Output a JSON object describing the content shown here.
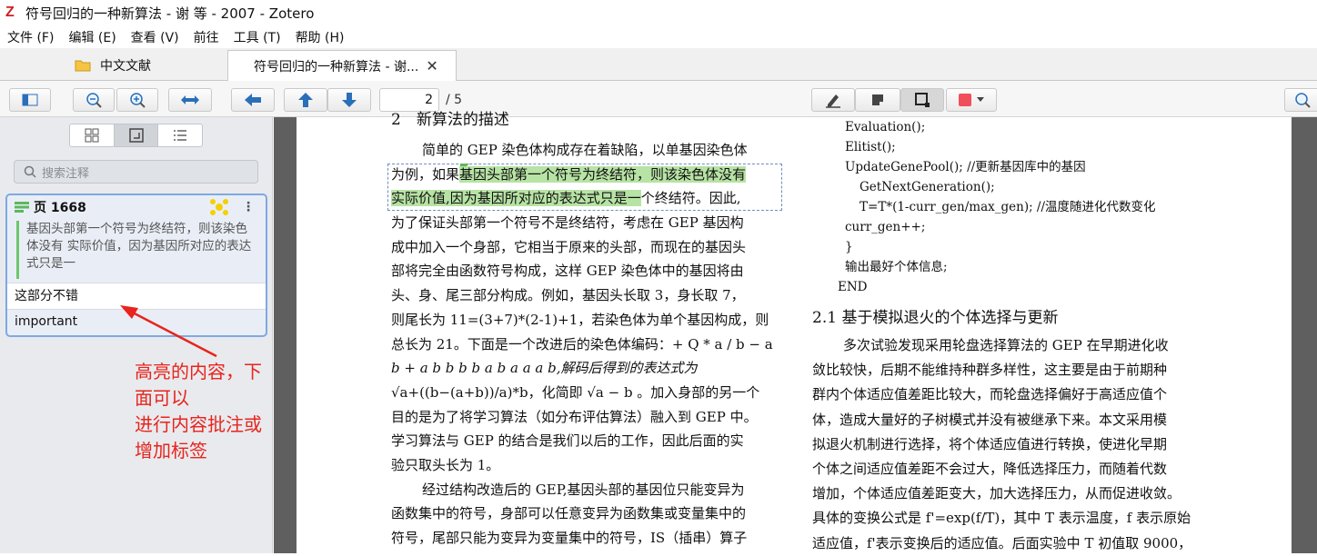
{
  "window": {
    "title": "符号回归的一种新算法 - 谢 等 - 2007 - Zotero"
  },
  "menu": [
    "文件 (F)",
    "编辑 (E)",
    "查看 (V)",
    "前往",
    "工具 (T)",
    "帮助 (H)"
  ],
  "tabs": [
    {
      "label": "中文文献"
    },
    {
      "label": "符号回归的一种新算法 - 谢...",
      "close": "✕"
    }
  ],
  "toolbar": {
    "page_current": "2",
    "page_total": "/ 5"
  },
  "sidebar": {
    "search_placeholder": "搜索注释",
    "annotation": {
      "page_label": "页 1668",
      "quote": "基因头部第一个符号为终结符，则该染色体没有 实际价值，因为基因所对应的表达式只是一",
      "comment": "这部分不错",
      "tag": "important"
    },
    "callout": [
      "高亮的内容，下面可以",
      "进行内容批注或增加标签"
    ]
  },
  "pdf": {
    "left_lines": [
      "简单的 GEP 染色体构成存在着缺陷，以单基因染色体",
      "为例，如果基因头部第一个符号为终结符，则该染色体没有",
      "实际价值,因为基因所对应的表达式只是一个终结符。因此,",
      "为了保证头部第一个符号不是终结符，考虑在 GEP 基因构",
      "成中加入一个身部，它相当于原来的头部，而现在的基因头",
      "部将完全由函数符号构成，这样 GEP 染色体中的基因将由",
      "头、身、尾三部分构成。例如，基因头长取 3，身长取 7，",
      "则尾长为 11=(3+7)*(2-1)+1，若染色体为单个基因构成，则",
      "总长为 21。下面是一个改进后的染色体编码：+ Q * a / b − a",
      "b + a b b b b a b a a a b,解码后得到的表达式为",
      "√a+((b−(a+b))/a)*b，化简即 √a − b 。加入身部的另一个",
      "目的是为了将学习算法（如分布评估算法）融入到 GEP 中。",
      "学习算法与 GEP 的结合是我们以后的工作，因此后面的实",
      "验只取头长为 1。",
      "经过结构改造后的 GEP,基因头部的基因位只能变异为",
      "函数集中的符号，身部可以任意变异为函数集或变量集中的",
      "符号，尾部只能为变异为变量集中的符号，IS（插串）算子"
    ],
    "left_hl_pre": "为例，如果",
    "left_hl_1": "基因头部第一个符号为终结符，则该染色体没有",
    "left_hl_2": "实际价值,因为基因所对应的表达式只是一",
    "left_hl_2_post": "个终结符。因此,",
    "right_code": [
      "Evaluation();",
      "Elitist();",
      "UpdateGenePool();        //更新基因库中的基因",
      "GetNextGeneration();",
      "T=T*(1-curr_gen/max_gen); //温度随进化代数变化",
      "curr_gen++;",
      "}",
      "输出最好个体信息;",
      "END"
    ],
    "section_title": "2.1  基于模拟退火的个体选择与更新",
    "right_body": [
      "多次试验发现采用轮盘选择算法的 GEP 在早期进化收",
      "敛比较快，后期不能维持种群多样性，这主要是由于前期种",
      "群内个体适应值差距比较大，而轮盘选择偏好于高适应值个",
      "体，造成大量好的子树模式并没有被继承下来。本文采用模",
      "拟退火机制进行选择，将个体适应值进行转换，使进化早期",
      "个体之间适应值差距不会过大，降低选择压力，而随着代数",
      "增加，个体适应值差距变大，加大选择压力，从而促进收敛。",
      "具体的变换公式是 f'=exp(f/T)，其中 T 表示温度，f 表示原始",
      "适应值，f'表示变换后的适应值。后面实验中 T 初值取 9000，"
    ]
  },
  "colors": {
    "highlight": "#b7e3a4",
    "callout": "#e8241c",
    "annotation_color_button": "#f0505a"
  }
}
